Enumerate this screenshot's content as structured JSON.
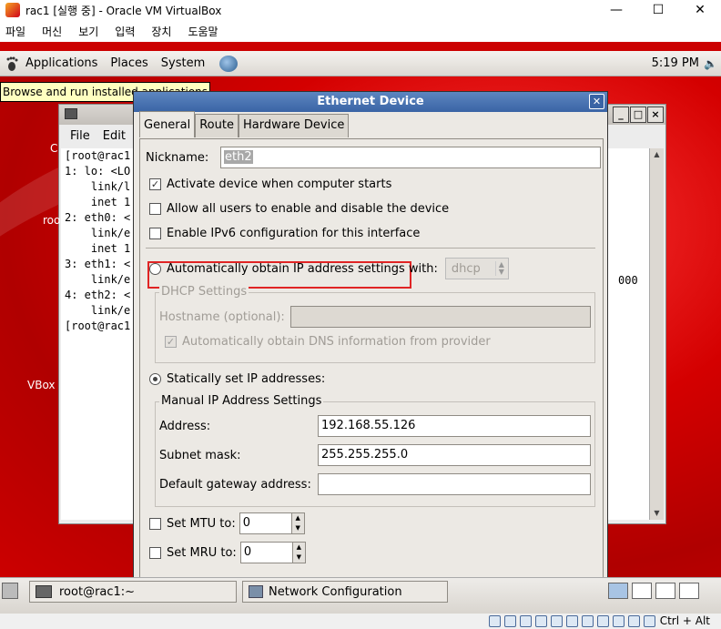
{
  "host": {
    "title": "rac1 [실행 중] - Oracle VM VirtualBox",
    "window_controls": [
      "—",
      "☐",
      "✕"
    ],
    "menu": [
      "파일",
      "머신",
      "보기",
      "입력",
      "장치",
      "도움말"
    ],
    "host_key": "Ctrl + Alt"
  },
  "panel": {
    "items": [
      "Applications",
      "Places",
      "System"
    ],
    "clock": "5:19 PM",
    "speaker_icon": "speaker-icon"
  },
  "tooltip": "Browse and run installed applications",
  "terminal": {
    "menu": [
      "File",
      "Edit"
    ],
    "lines": [
      "[root@rac1",
      "1: lo: <LO",
      "    link/l",
      "    inet 1",
      "2: eth0: <",
      "    link/e",
      "    inet 1",
      "3: eth1: <",
      "    link/e",
      "4: eth2: <",
      "    link/e",
      "[root@rac1"
    ],
    "partial_right": "000"
  },
  "desktop_labels": [
    "C",
    "roo",
    "VBox"
  ],
  "dialog": {
    "title": "Ethernet Device",
    "tabs": [
      "General",
      "Route",
      "Hardware Device"
    ],
    "nickname_label": "Nickname:",
    "nickname_value": "eth2",
    "activate_label": "Activate device when computer starts",
    "allow_users_label": "Allow all users to enable and disable the device",
    "ipv6_label": "Enable IPv6 configuration for this interface",
    "auto_ip_label": "Automatically obtain IP address settings with:",
    "auto_ip_method": "dhcp",
    "dhcp_group": "DHCP Settings",
    "hostname_label": "Hostname (optional):",
    "auto_dns_label": "Automatically obtain DNS information from provider",
    "static_label": "Statically set IP addresses:",
    "manual_group": "Manual IP Address Settings",
    "address_label": "Address:",
    "address_value": "192.168.55.126",
    "subnet_label": "Subnet mask:",
    "subnet_value": "255.255.255.0",
    "gateway_label": "Default gateway address:",
    "gateway_value": "",
    "mtu_label": "Set MTU to:",
    "mtu_value": "0",
    "mru_label": "Set MRU to:",
    "mru_value": "0"
  },
  "taskbar": {
    "terminal_task": "root@rac1:~",
    "network_task": "Network Configuration"
  }
}
